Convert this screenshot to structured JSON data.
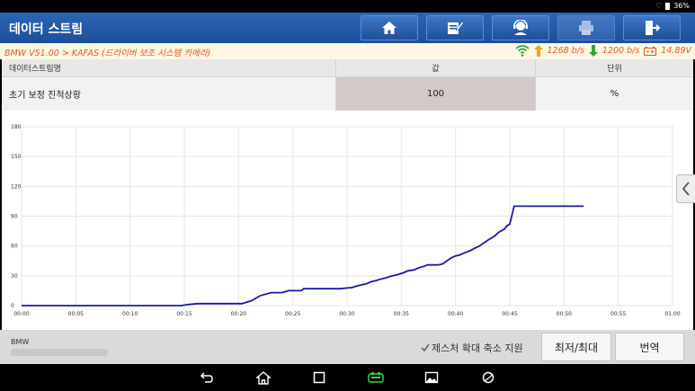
{
  "status": {
    "battery_label": "36%"
  },
  "app": {
    "title": "데이터 스트림"
  },
  "toolbar": {
    "buttons": [
      {
        "icon": "home-icon"
      },
      {
        "icon": "edit-icon"
      },
      {
        "icon": "user-support-icon"
      },
      {
        "icon": "print-icon"
      },
      {
        "icon": "exit-icon"
      }
    ]
  },
  "info": {
    "path": "BMW V51.00 > KAFAS (드라이버 보조 시스템 카메라)",
    "upload_rate": "1268 b/s",
    "download_rate": "1200 b/s",
    "voltage": "14.89V",
    "colors": {
      "accent": "#e0572a",
      "up_arrow": "#f2a516",
      "down_arrow": "#2fa63a",
      "wifi": "#2fa63a"
    }
  },
  "table": {
    "headers": {
      "name": "데이터스트림명",
      "value": "값",
      "unit": "단위"
    },
    "rows": [
      {
        "name": "초기 보정 진척상황",
        "value": "100",
        "unit": "%"
      }
    ]
  },
  "chart_data": {
    "type": "line",
    "title": "",
    "xlabel": "",
    "ylabel": "",
    "x_ticks": [
      "00:00",
      "00:05",
      "00:10",
      "00:15",
      "00:20",
      "00:25",
      "00:30",
      "00:35",
      "00:40",
      "00:45",
      "00:50",
      "00:55",
      "01:00"
    ],
    "y_ticks": [
      0,
      30,
      60,
      90,
      120,
      150,
      180
    ],
    "xlim_seconds": [
      0,
      60
    ],
    "ylim": [
      0,
      180
    ],
    "grid": true,
    "line_color": "#1a1aa6",
    "series": [
      {
        "x": [
          0,
          14.7,
          15.3,
          16.2,
          20.3,
          21.2,
          22.0,
          23.0,
          23.8,
          24.0,
          24.6,
          25.8,
          26.0,
          28.0,
          29.4,
          30.2,
          30.4,
          31.0,
          31.4,
          31.8,
          32.2,
          32.6,
          33.2,
          33.6,
          34.2,
          34.6,
          35.2,
          35.6,
          36.2,
          36.6,
          37.2,
          37.4,
          38.0,
          38.4,
          38.8,
          39.2,
          39.6,
          40.0,
          40.4,
          40.8,
          41.3,
          41.8,
          42.2,
          42.6,
          43.0,
          43.6,
          44.0,
          44.5,
          44.7,
          45.0,
          45.4,
          51.8
        ],
        "y": [
          0,
          0,
          1,
          2,
          2,
          5,
          10,
          13,
          13,
          13,
          15,
          15,
          17,
          17,
          17,
          18,
          18,
          20,
          21,
          22,
          24,
          25,
          27,
          28,
          30,
          31,
          33,
          35,
          36,
          38,
          40,
          41,
          41,
          41,
          42,
          45,
          48,
          50,
          51,
          53,
          55,
          58,
          60,
          63,
          66,
          70,
          74,
          77,
          80,
          82,
          100,
          100
        ]
      }
    ]
  },
  "side": {
    "collapse_icon": "chevron-left-icon"
  },
  "bottom": {
    "brand": "BMW",
    "gesture_label": "제스처 확대 축소 지원",
    "minmax_label": "최저/최대",
    "translate_label": "번역"
  },
  "navbar": {
    "icons": [
      "back-icon",
      "home-icon",
      "recent-apps-icon",
      "vci-icon",
      "gallery-icon",
      "browser-icon"
    ]
  }
}
